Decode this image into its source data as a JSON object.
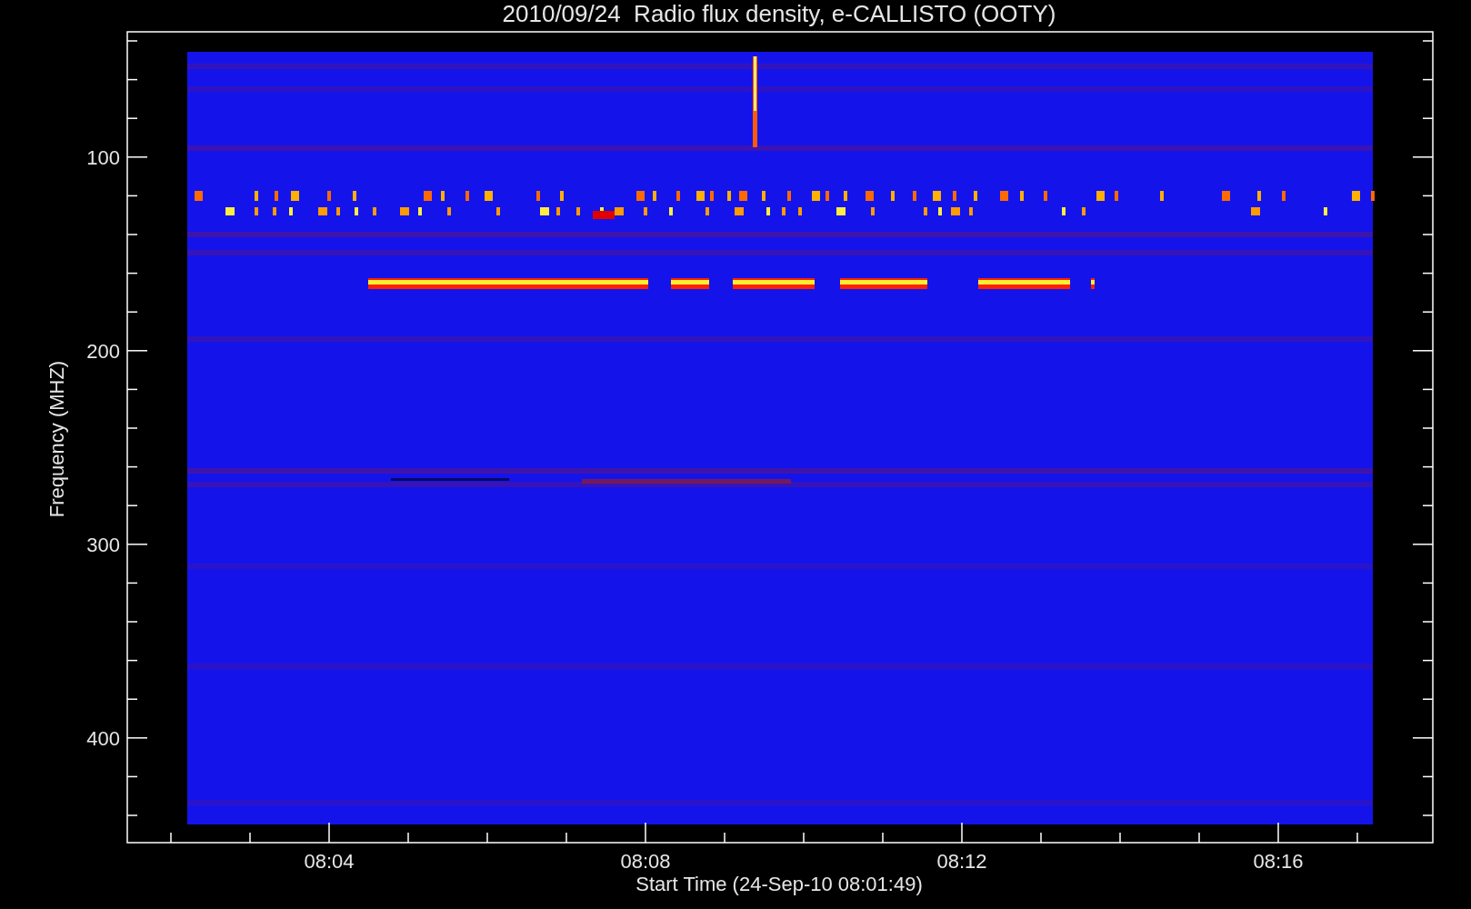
{
  "title": "2010/09/24  Radio flux density, e-CALLISTO (OOTY)",
  "y_axis": {
    "label": "Frequency (MHZ)",
    "ticks": [
      "100",
      "200",
      "300",
      "400"
    ]
  },
  "x_axis": {
    "label": "Start Time (24-Sep-10 08:01:49)",
    "ticks": [
      "08:04",
      "08:08",
      "08:12",
      "08:16"
    ]
  }
}
